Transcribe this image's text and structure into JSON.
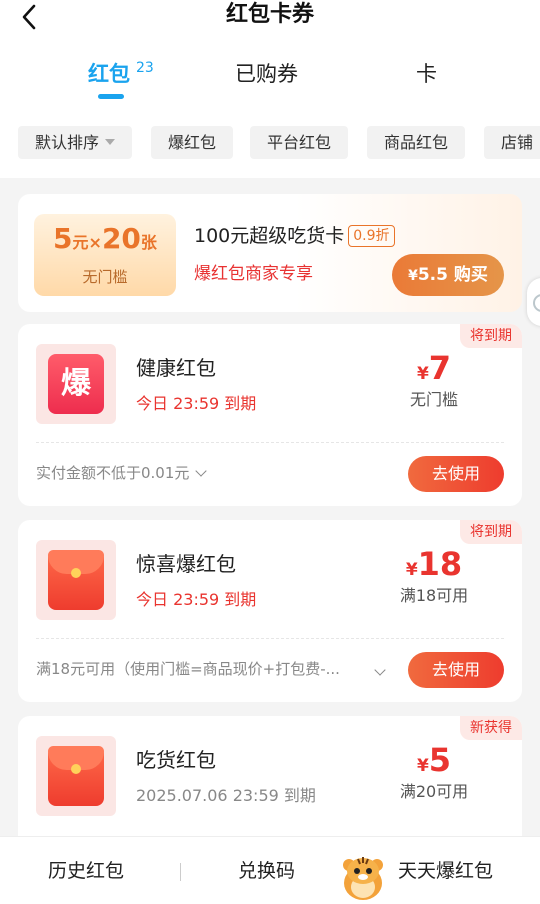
{
  "header": {
    "title": "红包卡券"
  },
  "tabs": [
    {
      "label": "红包",
      "count": "23"
    },
    {
      "label": "已购券"
    },
    {
      "label": "卡"
    }
  ],
  "filters": [
    "默认排序",
    "爆红包",
    "平台红包",
    "商品红包",
    "店铺"
  ],
  "promo": {
    "ticket_amount": "5",
    "ticket_unit": "元",
    "ticket_times": "×",
    "ticket_qty": "20",
    "ticket_qty_unit": "张",
    "ticket_sub": "无门槛",
    "title": "100元超级吃货卡",
    "discount": "0.9折",
    "subtitle": "爆红包商家专享",
    "buy_prefix": "¥",
    "buy_label": "5.5 购买"
  },
  "coupons": [
    {
      "badge": "将到期",
      "icon": "bao-icon",
      "icon_text": "爆",
      "name": "健康红包",
      "expiry": "今日 23:59 到期",
      "amount": "7",
      "condition": "无门槛",
      "note": "实付金额不低于0.01元",
      "action": "去使用"
    },
    {
      "badge": "将到期",
      "icon": "red-envelope-icon",
      "name": "惊喜爆红包",
      "expiry": "今日 23:59 到期",
      "amount": "18",
      "condition": "满18可用",
      "note": "满18元可用（使用门槛=商品现价+打包费-...",
      "action": "去使用"
    },
    {
      "badge": "新获得",
      "icon": "red-envelope-icon",
      "name": "吃货红包",
      "expiry": "2025.07.06 23:59 到期",
      "amount": "5",
      "condition": "满20可用"
    }
  ],
  "currency": "¥",
  "bottom_bar": {
    "history": "历史红包",
    "redeem": "兑换码",
    "daily": "天天爆红包"
  },
  "colors": {
    "accent_blue": "#1aa3ee",
    "red": "#e9342f",
    "orange": "#ea7a37"
  }
}
